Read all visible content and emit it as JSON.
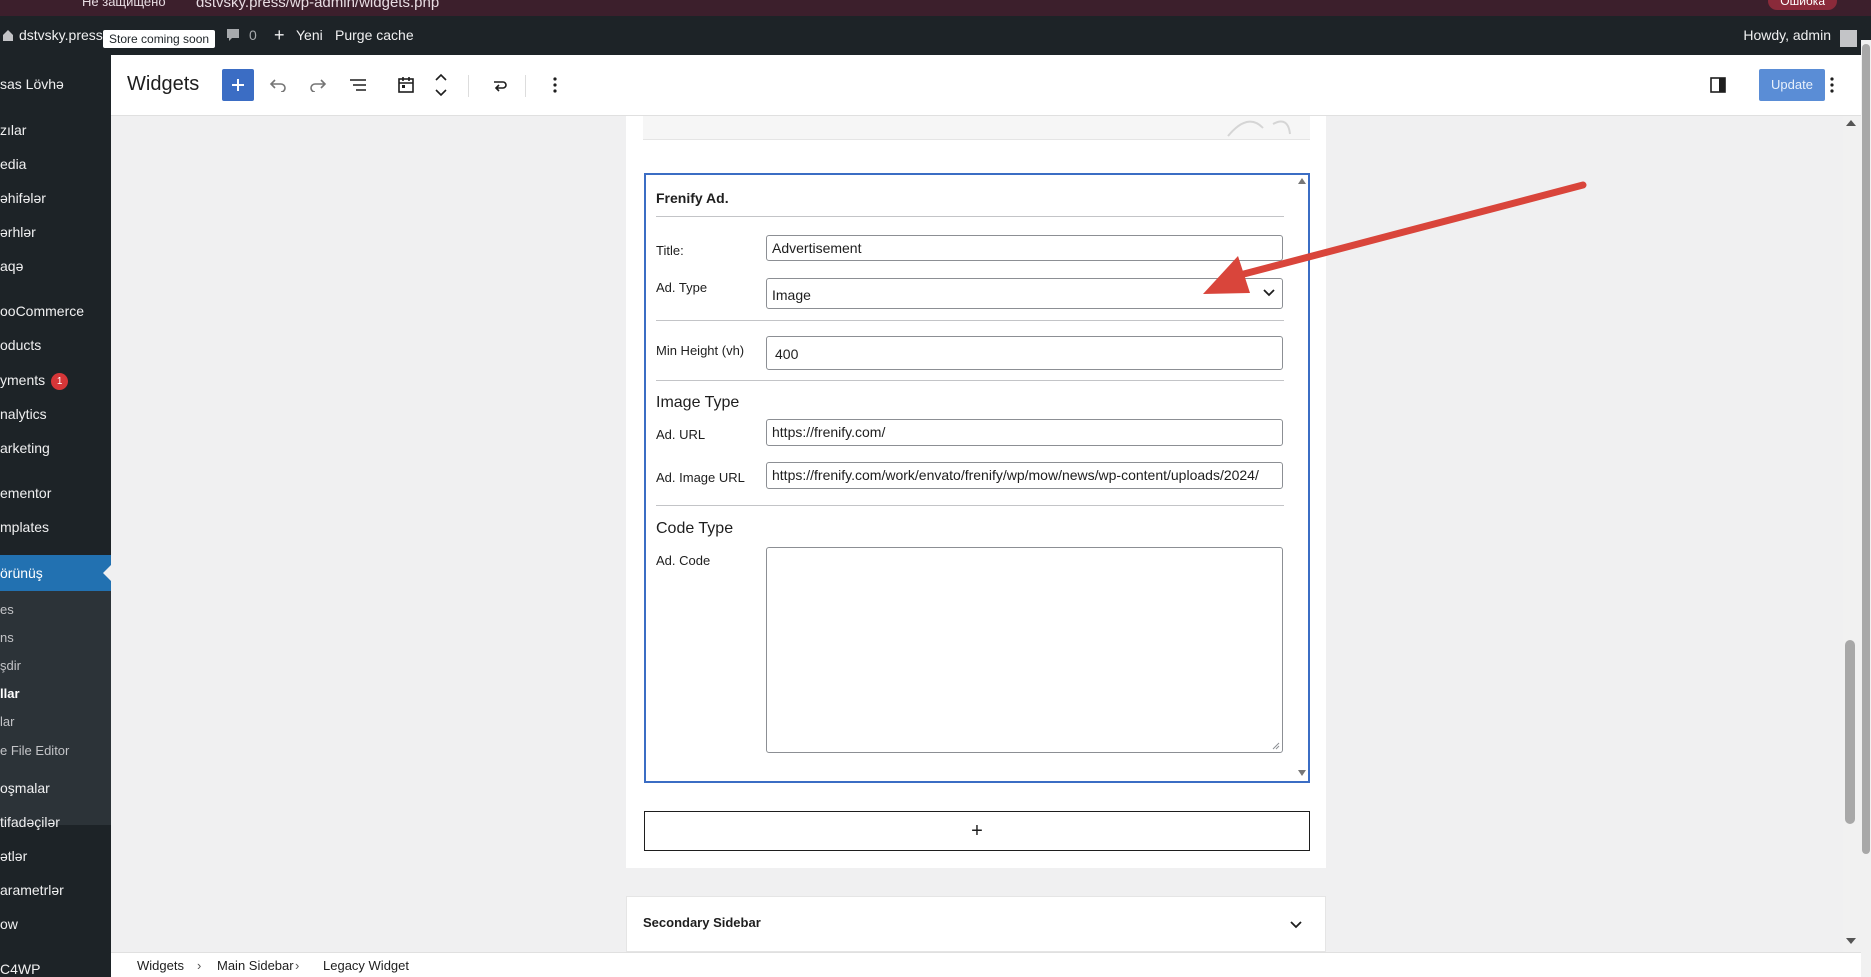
{
  "browser": {
    "warning": "Не защищено",
    "url": "dstvsky.press/wp-admin/widgets.php",
    "error_badge": "Ошибка"
  },
  "adminbar": {
    "site_name": "dstvsky.press",
    "store_badge": "Store coming soon",
    "comments_count": "0",
    "new_label": "Yeni",
    "purge_label": "Purge cache",
    "howdy": "Howdy, admin"
  },
  "menu": {
    "items": [
      {
        "label": "sas Lövhə"
      },
      {
        "label": "zılar"
      },
      {
        "label": "edia"
      },
      {
        "label": "əhifələr"
      },
      {
        "label": "ərhlər"
      },
      {
        "label": "aqə"
      },
      {
        "label": "ooCommerce"
      },
      {
        "label": "oducts"
      },
      {
        "label": "yments",
        "badge": "1"
      },
      {
        "label": "nalytics"
      },
      {
        "label": "arketing"
      },
      {
        "label": "ementor"
      },
      {
        "label": "mplates"
      },
      {
        "label": "örünüş"
      },
      {
        "label": "oşmalar"
      },
      {
        "label": "tifadəçilər"
      },
      {
        "label": "ətlər"
      },
      {
        "label": "arametrlər"
      },
      {
        "label": "ow"
      },
      {
        "label": "C4WP"
      }
    ],
    "submenu": [
      {
        "label": "es"
      },
      {
        "label": "ns"
      },
      {
        "label": "şdir"
      },
      {
        "label": "llar"
      },
      {
        "label": "lar"
      },
      {
        "label": "e File Editor"
      }
    ]
  },
  "editor": {
    "title": "Widgets",
    "update_label": "Update"
  },
  "widget": {
    "heading": "Frenify Ad.",
    "title_label": "Title:",
    "title_value": "Advertisement",
    "ad_type_label": "Ad. Type",
    "ad_type_value": "Image",
    "min_height_label": "Min Height (vh)",
    "min_height_value": "400",
    "image_type_heading": "Image Type",
    "ad_url_label": "Ad. URL",
    "ad_url_value": "https://frenify.com/",
    "ad_image_url_label": "Ad. Image URL",
    "ad_image_url_value": "https://frenify.com/work/envato/frenify/wp/mow/news/wp-content/uploads/2024/",
    "code_type_heading": "Code Type",
    "ad_code_label": "Ad. Code",
    "ad_code_value": ""
  },
  "add_block_label": "+",
  "secondary_sidebar": {
    "title": "Secondary Sidebar"
  },
  "breadcrumb": [
    "Widgets",
    "Main Sidebar",
    "Legacy Widget"
  ],
  "colors": {
    "admin_dark": "#1d2327",
    "accent": "#3b6dc4",
    "arrow": "#d9453b"
  }
}
